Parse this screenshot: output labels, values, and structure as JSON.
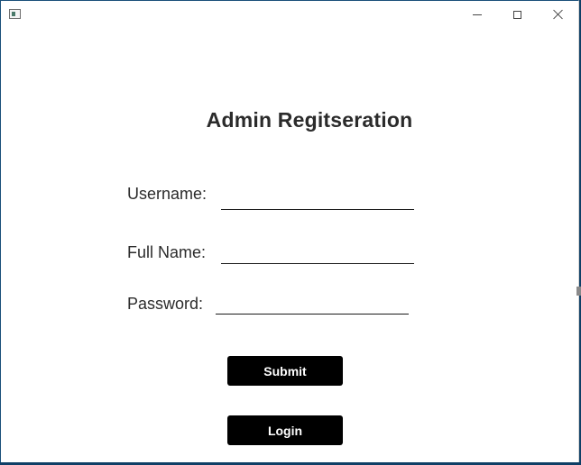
{
  "window": {
    "icon": "app-window-icon",
    "controls": {
      "minimize": "minimize-icon",
      "maximize": "maximize-icon",
      "close": "close-icon"
    }
  },
  "form": {
    "title": "Admin Regitseration",
    "fields": {
      "username": {
        "label": "Username:",
        "value": "",
        "placeholder": ""
      },
      "fullname": {
        "label": "Full Name:",
        "value": "",
        "placeholder": ""
      },
      "password": {
        "label": "Password:",
        "value": "",
        "placeholder": ""
      }
    },
    "buttons": {
      "submit": "Submit",
      "login": "Login"
    }
  },
  "colors": {
    "button_bg": "#000000",
    "button_text": "#ffffff",
    "text": "#2b2b2b",
    "window_border": "#0f3f66"
  }
}
